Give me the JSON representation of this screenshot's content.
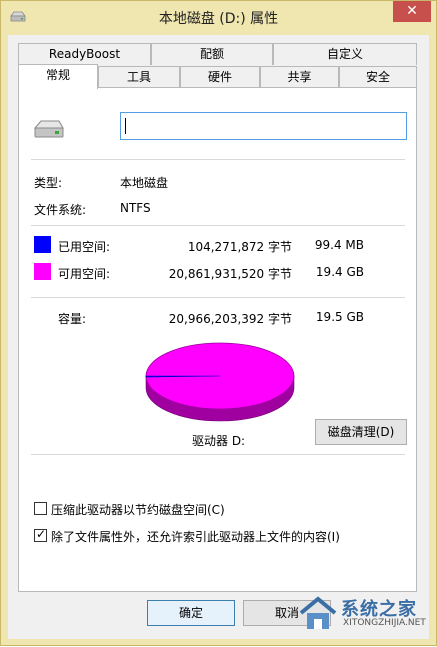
{
  "window": {
    "title": "本地磁盘 (D:) 属性",
    "close_glyph": "✕"
  },
  "tabs_row1": [
    {
      "label": "ReadyBoost"
    },
    {
      "label": "配额"
    },
    {
      "label": "自定义"
    }
  ],
  "tabs_row2": [
    {
      "label": "常规",
      "active": true
    },
    {
      "label": "工具"
    },
    {
      "label": "硬件"
    },
    {
      "label": "共享"
    },
    {
      "label": "安全"
    }
  ],
  "general": {
    "name_value": "",
    "type_label": "类型:",
    "type_value": "本地磁盘",
    "fs_label": "文件系统:",
    "fs_value": "NTFS",
    "used": {
      "label": "已用空间:",
      "bytes": "104,271,872 字节",
      "size": "99.4 MB",
      "color": "#0000ff"
    },
    "free": {
      "label": "可用空间:",
      "bytes": "20,861,931,520 字节",
      "size": "19.4 GB",
      "color": "#ff00ff"
    },
    "capacity": {
      "label": "容量:",
      "bytes": "20,966,203,392 字节",
      "size": "19.5 GB"
    },
    "drive_label": "驱动器 D:",
    "cleanup_button": "磁盘清理(D)",
    "used_fraction": 0.005
  },
  "options": {
    "compress": {
      "label": "压缩此驱动器以节约磁盘空间(C)",
      "checked": false
    },
    "index": {
      "label": "除了文件属性外，还允许索引此驱动器上文件的内容(I)",
      "checked": true
    }
  },
  "buttons": {
    "ok": "确定",
    "cancel": "取消"
  },
  "watermark": {
    "title": "系统之家",
    "subtitle": "XITONGZHIJIA.NET"
  }
}
